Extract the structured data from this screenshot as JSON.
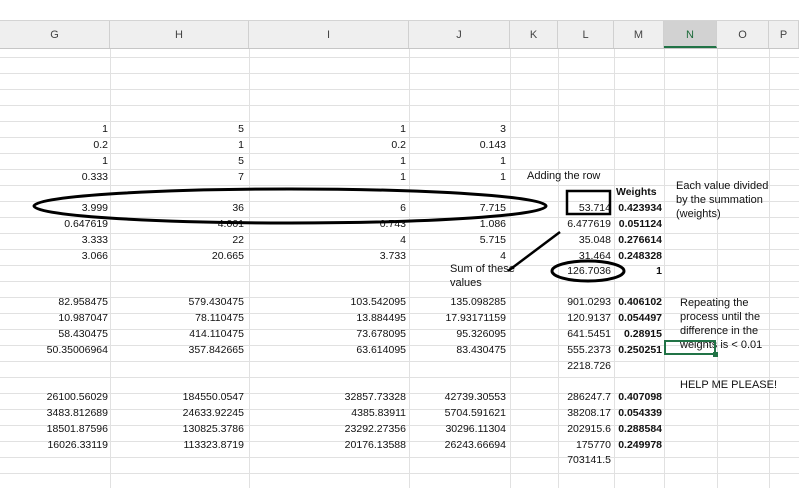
{
  "columns": [
    "G",
    "H",
    "I",
    "J",
    "K",
    "L",
    "M",
    "N",
    "O",
    "P"
  ],
  "selected_column": "N",
  "block1": [
    [
      "1",
      "5",
      "1",
      "3"
    ],
    [
      "0.2",
      "1",
      "0.2",
      "0.143"
    ],
    [
      "1",
      "5",
      "1",
      "1"
    ],
    [
      "0.333",
      "7",
      "1",
      "1"
    ]
  ],
  "block2": [
    [
      "3.999",
      "36",
      "6",
      "7.715",
      "53.714",
      "0.423934"
    ],
    [
      "0.647619",
      "4.001",
      "0.743",
      "1.086",
      "6.477619",
      "0.051124"
    ],
    [
      "3.333",
      "22",
      "4",
      "5.715",
      "35.048",
      "0.276614"
    ],
    [
      "3.066",
      "20.665",
      "3.733",
      "4",
      "31.464",
      "0.248328"
    ]
  ],
  "block2_total": "126.7036",
  "block2_weight_total": "1",
  "block3": [
    [
      "82.958475",
      "579.430475",
      "103.542095",
      "135.098285",
      "901.0293",
      "0.406102"
    ],
    [
      "10.987047",
      "78.110475",
      "13.884495",
      "17.93171159",
      "120.9137",
      "0.054497"
    ],
    [
      "58.430475",
      "414.110475",
      "73.678095",
      "95.326095",
      "641.5451",
      "0.28915"
    ],
    [
      "50.35006964",
      "357.842665",
      "63.614095",
      "83.430475",
      "555.2373",
      "0.250251"
    ]
  ],
  "block3_total": "2218.726",
  "block4": [
    [
      "26100.56029",
      "184550.0547",
      "32857.73328",
      "42739.30553",
      "286247.7",
      "0.407098"
    ],
    [
      "3483.812689",
      "24633.92245",
      "4385.83911",
      "5704.591621",
      "38208.17",
      "0.054339"
    ],
    [
      "18501.87596",
      "130825.3786",
      "23292.27356",
      "30296.11304",
      "202915.6",
      "0.288584"
    ],
    [
      "16026.33119",
      "113323.8719",
      "20176.13588",
      "26243.66694",
      "175770",
      "0.249978"
    ]
  ],
  "block4_total": "703141.5",
  "notes": {
    "adding_row": "Adding the row",
    "weights": "Weights",
    "each_value": "Each value divided\nby the summation\n(weights)",
    "sum_values": "Sum of these\nvalues",
    "repeating": "Repeating the\nprocess until the\ndifference in the\nweights is < 0.01",
    "help": "HELP ME PLEASE!"
  }
}
